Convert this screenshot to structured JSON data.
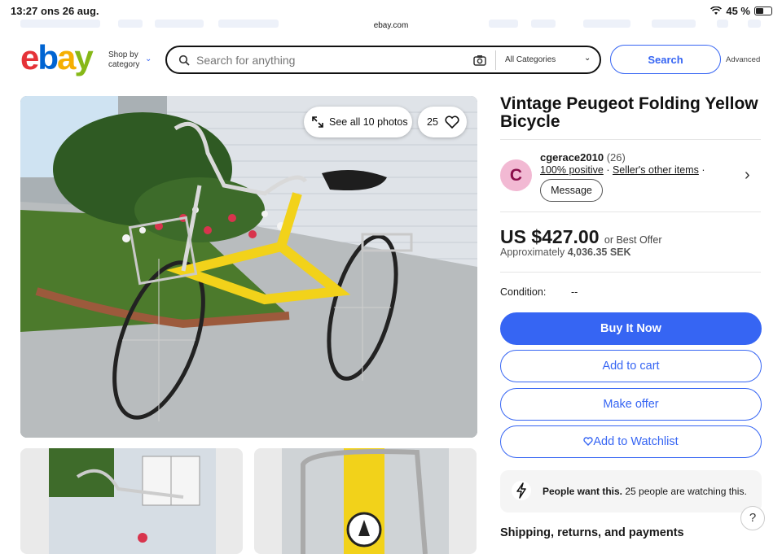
{
  "status_bar": {
    "time": "13:27",
    "date": "ons 26 aug.",
    "battery": "45 %"
  },
  "browser": {
    "url": "ebay.com"
  },
  "header": {
    "logo_text": "ebay",
    "shop_by_line1": "Shop by",
    "shop_by_line2": "category",
    "search_placeholder": "Search for anything",
    "category_select": "All Categories",
    "search_button": "Search",
    "advanced_link": "Advanced"
  },
  "gallery": {
    "see_all_label": "See all 10 photos",
    "watch_count": "25"
  },
  "listing": {
    "title": "Vintage Peugeot Folding Yellow Bicycle",
    "seller": {
      "avatar_letter": "C",
      "name": "cgerace2010",
      "feedback_count": "(26)",
      "positive": "100% positive",
      "other_items": "Seller's other items",
      "message_button": "Message"
    },
    "price": "US $427.00",
    "best_offer": "or Best Offer",
    "approx_prefix": "Approximately",
    "approx_value": "4,036.35 SEK",
    "condition_label": "Condition:",
    "condition_value": "--",
    "buy_now": "Buy It Now",
    "add_to_cart": "Add to cart",
    "make_offer": "Make offer",
    "add_to_watchlist": "Add to Watchlist",
    "urgency_bold": "People want this.",
    "urgency_text": "25 people are watching this.",
    "shipping_heading": "Shipping, returns, and payments"
  },
  "help_label": "?",
  "colors": {
    "accent": "#3665f3",
    "bike_yellow": "#f2d21a"
  }
}
